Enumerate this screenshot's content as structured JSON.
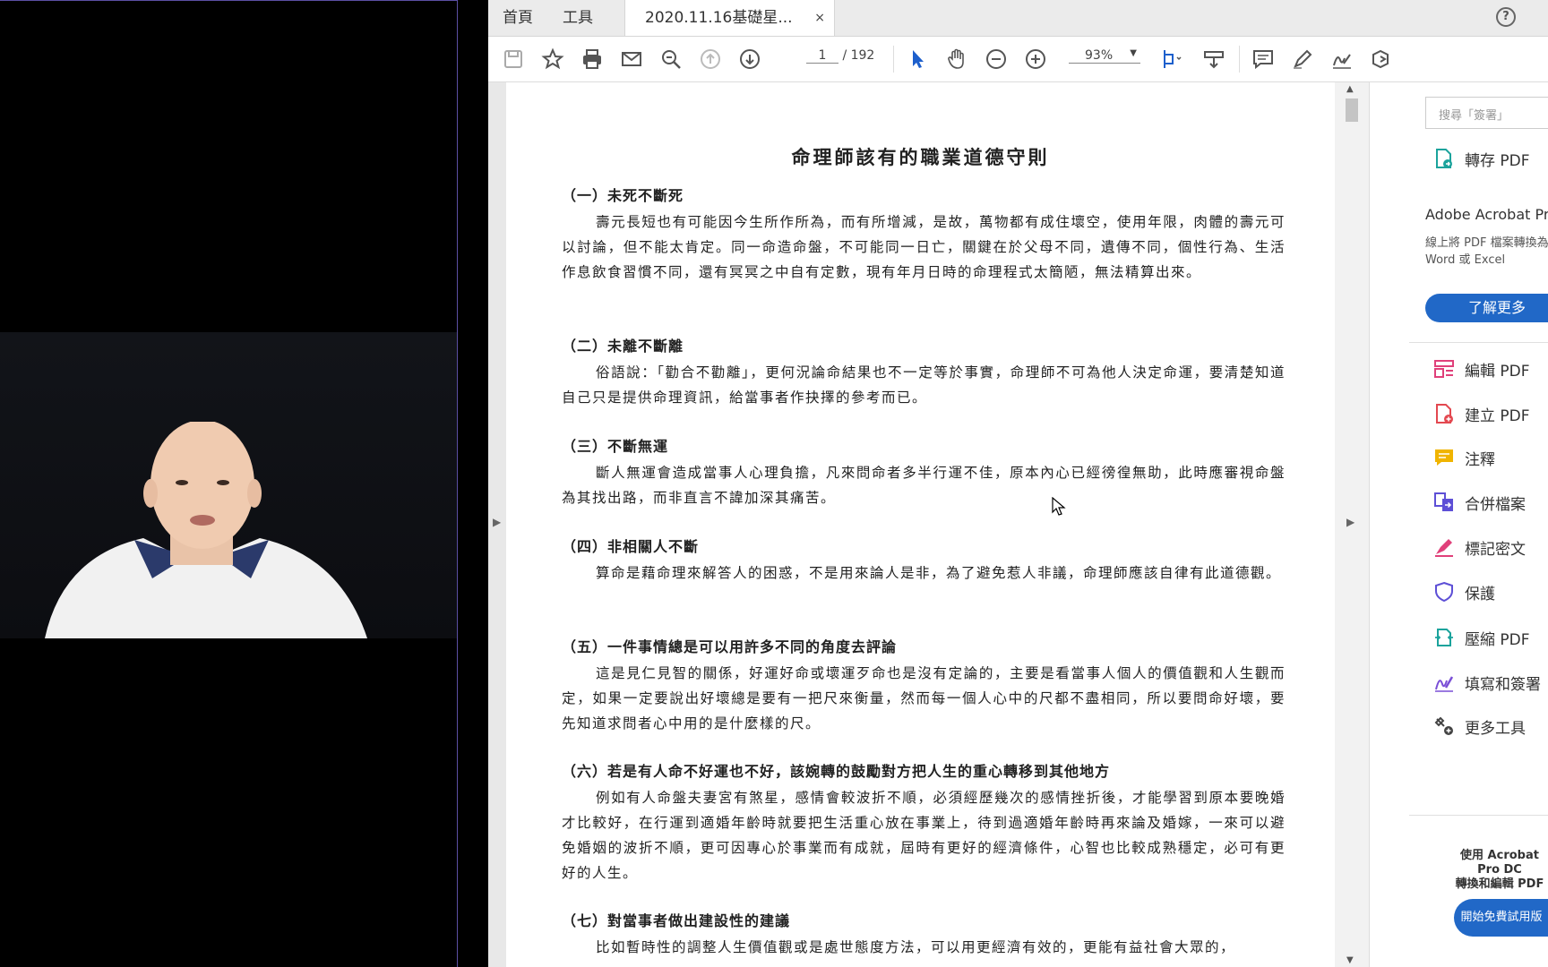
{
  "tabs": {
    "home": "首頁",
    "tools": "工具",
    "document": "2020.11.16基礎星...",
    "close": "×"
  },
  "toolbar": {
    "current_page": "1",
    "total_pages": "/ 192",
    "zoom": "93%",
    "icons": [
      "save-icon",
      "star-icon",
      "print-icon",
      "mail-icon",
      "zoom-search-icon",
      "prev-page-icon",
      "next-page-icon",
      "select-arrow-icon",
      "hand-icon",
      "zoom-out-icon",
      "zoom-in-icon",
      "fit-page-icon",
      "read-mode-icon",
      "comment-icon",
      "highlight-pen-icon",
      "sign-icon",
      "share-icon"
    ]
  },
  "document": {
    "title": "命理師該有的職業道德守則",
    "sections": [
      {
        "heading": "（一）未死不斷死",
        "body": "壽元長短也有可能因今生所作所為，而有所增減，是故，萬物都有成住壞空，使用年限，肉體的壽元可以討論，但不能太肯定。同一命造命盤，不可能同一日亡，關鍵在於父母不同，遺傳不同，個性行為、生活作息飲食習慣不同，還有冥冥之中自有定數，現有年月日時的命理程式太簡陋，無法精算出來。"
      },
      {
        "heading": "（二）未離不斷離",
        "body": "俗語說：「勸合不勸離」，更何況論命結果也不一定等於事實，命理師不可為他人決定命運，要清楚知道自己只是提供命理資訊，給當事者作抉擇的參考而已。"
      },
      {
        "heading": "（三）不斷無運",
        "body": "斷人無運會造成當事人心理負擔，凡來問命者多半行運不佳，原本內心已經徬徨無助，此時應審視命盤為其找出路，而非直言不諱加深其痛苦。"
      },
      {
        "heading": "（四）非相關人不斷",
        "body": "算命是藉命理來解答人的困惑，不是用來論人是非，為了避免惹人非議，命理師應該自律有此道德觀。"
      },
      {
        "heading": "（五）一件事情總是可以用許多不同的角度去評論",
        "body": "這是見仁見智的關係，好運好命或壞運歹命也是沒有定論的，主要是看當事人個人的價值觀和人生觀而定，如果一定要說出好壞總是要有一把尺來衡量，然而每一個人心中的尺都不盡相同，所以要問命好壞，要先知道求問者心中用的是什麼樣的尺。"
      },
      {
        "heading": "（六）若是有人命不好運也不好，該婉轉的鼓勵對方把人生的重心轉移到其他地方",
        "body": "例如有人命盤夫妻宮有煞星，感情會較波折不順，必須經歷幾次的感情挫折後，才能學習到原本要晚婚才比較好，在行運到適婚年齡時就要把生活重心放在事業上，待到過適婚年齡時再來論及婚嫁，一來可以避免婚姻的波折不順，更可因專心於事業而有成就，屆時有更好的經濟條件，心智也比較成熟穩定，必可有更好的人生。"
      },
      {
        "heading": "（七）對當事者做出建設性的建議",
        "body": "比如暫時性的調整人生價值觀或是處世態度方法，可以用更經濟有效的，更能有益社會大眾的，"
      }
    ]
  },
  "right_pane": {
    "search_placeholder": "搜尋「簽署」",
    "export_pdf": "轉存 PDF",
    "promo_title": "Adobe Acrobat Pro DC",
    "promo_desc": "線上將 PDF 檔案轉換為 Word 或 Excel",
    "learn_more": "了解更多",
    "tools": [
      {
        "label": "編輯 PDF",
        "icon": "edit-pdf-icon",
        "color": "#e0407a"
      },
      {
        "label": "建立 PDF",
        "icon": "create-pdf-icon",
        "color": "#e34850"
      },
      {
        "label": "注釋",
        "icon": "comment-tool-icon",
        "color": "#f0b400"
      },
      {
        "label": "合併檔案",
        "icon": "combine-files-icon",
        "color": "#5d4fd6"
      },
      {
        "label": "標記密文",
        "icon": "redact-icon",
        "color": "#e0407a"
      },
      {
        "label": "保護",
        "icon": "protect-icon",
        "color": "#5d4fd6"
      },
      {
        "label": "壓縮 PDF",
        "icon": "compress-pdf-icon",
        "color": "#1ba39c"
      },
      {
        "label": "填寫和簽署",
        "icon": "fill-sign-icon",
        "color": "#7a4fd6"
      },
      {
        "label": "更多工具",
        "icon": "more-tools-icon",
        "color": "#444444"
      }
    ],
    "bottom_promo": "使用 Acrobat Pro DC\n轉換和編輯 PDF",
    "trial_button": "開始免費試用版"
  }
}
